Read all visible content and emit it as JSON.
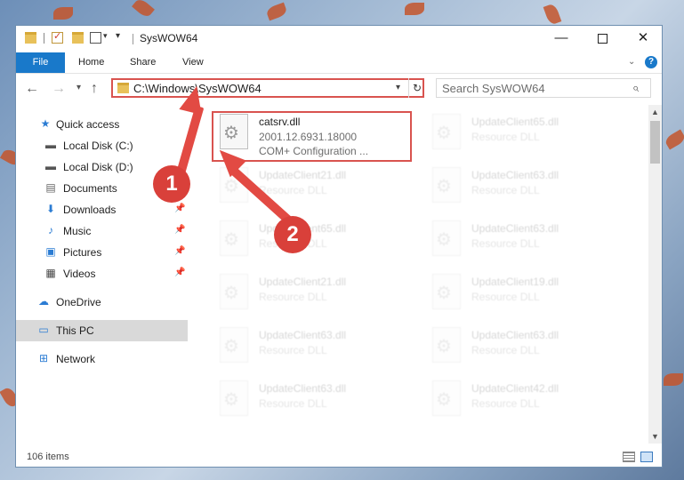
{
  "window": {
    "title": "SysWOW64"
  },
  "ribbon": {
    "tabs": [
      "File",
      "Home",
      "Share",
      "View"
    ],
    "accent": "#1979ca"
  },
  "address": {
    "path": "C:\\Windows\\SysWOW64"
  },
  "search": {
    "placeholder": "Search SysWOW64"
  },
  "navigation": {
    "items": [
      {
        "label": "Quick access",
        "icon": "star-icon",
        "pinned": false
      },
      {
        "label": "Local Disk (C:)",
        "icon": "drive-icon",
        "pinned": false
      },
      {
        "label": "Local Disk (D:)",
        "icon": "drive-icon",
        "pinned": false
      },
      {
        "label": "Documents",
        "icon": "documents-icon",
        "pinned": false
      },
      {
        "label": "Downloads",
        "icon": "download-icon",
        "pinned": true
      },
      {
        "label": "Music",
        "icon": "music-icon",
        "pinned": true
      },
      {
        "label": "Pictures",
        "icon": "pictures-icon",
        "pinned": true
      },
      {
        "label": "Videos",
        "icon": "videos-icon",
        "pinned": true
      },
      {
        "label": "OneDrive",
        "icon": "cloud-icon",
        "pinned": false
      },
      {
        "label": "This PC",
        "icon": "computer-icon",
        "pinned": false,
        "selected": true
      },
      {
        "label": "Network",
        "icon": "network-icon",
        "pinned": false
      }
    ]
  },
  "files": [
    {
      "name": "catsrv.dll",
      "line1": "2001.12.6931.18000",
      "line2": "COM+ Configuration ...",
      "highlighted": true
    },
    {
      "name": "UpdateClient65.dll",
      "line1": "Resource DLL"
    },
    {
      "name": "UpdateClient21.dll",
      "line1": "Resource DLL"
    },
    {
      "name": "UpdateClient63.dll",
      "line1": "Resource DLL"
    },
    {
      "name": "UpdateClient65.dll",
      "line1": "Resource DLL"
    },
    {
      "name": "UpdateClient63.dll",
      "line1": "Resource DLL"
    },
    {
      "name": "UpdateClient21.dll",
      "line1": "Resource DLL"
    },
    {
      "name": "UpdateClient19.dll",
      "line1": "Resource DLL"
    },
    {
      "name": "UpdateClient63.dll",
      "line1": "Resource DLL"
    },
    {
      "name": "UpdateClient63.dll",
      "line1": "Resource DLL"
    },
    {
      "name": "UpdateClient63.dll",
      "line1": "Resource DLL"
    },
    {
      "name": "UpdateClient42.dll",
      "line1": "Resource DLL"
    }
  ],
  "status": {
    "count": "106 items"
  },
  "callouts": [
    {
      "number": "1"
    },
    {
      "number": "2"
    }
  ],
  "colors": {
    "callout": "#e24a43",
    "highlight": "#d9534f",
    "selected": "#d9d9d9"
  }
}
